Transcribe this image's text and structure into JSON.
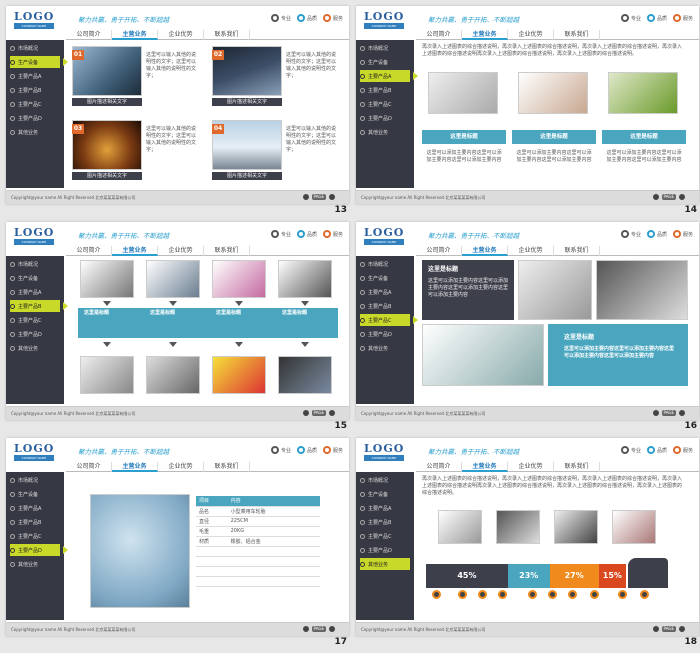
{
  "common": {
    "logo": "LOGO",
    "logo_sub": "COMPANY NAME",
    "slogan": "聚力共赢、勇于开拓、不断超越",
    "icons": [
      "专业",
      "品质",
      "服务"
    ],
    "tabs": [
      "公司简介",
      "主营业务",
      "企业优势",
      "联系我们"
    ],
    "sidebar": [
      "市场概况",
      "生产设备",
      "主要产品A",
      "主要产品B",
      "主要产品C",
      "主要产品D",
      "其他业务"
    ],
    "copyright": "Copyright@your name All Right Reserved 北京某某某某有限公司",
    "pager": "PAGE"
  },
  "slides": [
    {
      "number": "13",
      "active": 1,
      "items": [
        {
          "badge": "01",
          "caption": "图片描述相关文字",
          "text": "这里可以输入其他的说明性的文字；这里可以输入其他的说明性的文字；"
        },
        {
          "badge": "02",
          "caption": "图片描述相关文字",
          "text": "这里可以输入其他的说明性的文字；这里可以输入其他的说明性的文字；"
        },
        {
          "badge": "03",
          "caption": "图片描述相关文字",
          "text": "这里可以输入其他的说明性的文字；这里可以输入其他的说明性的文字；"
        },
        {
          "badge": "04",
          "caption": "图片描述相关文字",
          "text": "这里可以输入其他的说明性的文字；这里可以输入其他的说明性的文字；"
        }
      ]
    },
    {
      "number": "14",
      "active": 2,
      "intro": "再次录入上述图表的综合描述说明，再次录入上述图表的综合描述说明，再次录入上述图表的综合描述说明，再次录入上述图表的综合描述说明再次录入上述图表的综合描述说明，再次录入上述图表的综合描述说明。",
      "titles": [
        "这里是标题",
        "这里是标题",
        "这里是标题"
      ],
      "desc": "这里可以添加主要内容这里可以添加主要内容这里可以添加主要内容"
    },
    {
      "number": "15",
      "active": 3,
      "titles": [
        "这里是标题",
        "这里是标题",
        "这里是标题",
        "这里是标题"
      ]
    },
    {
      "number": "16",
      "active": 4,
      "box1_title": "这里是标题",
      "box1_text": "这里可以添加主要内容这里可以添加主要内容这里可以添加主要内容这里可以添加主要内容",
      "box2_title": "这里是标题",
      "box2_text": "这里可以添加主要内容这里可以添加主要内容这里可以添加主要内容这里可以添加主要内容"
    },
    {
      "number": "17",
      "active": 5,
      "table": {
        "head": [
          "项目",
          "内容"
        ],
        "rows": [
          [
            "品名",
            "小型乘用车轮胎"
          ],
          [
            "直径",
            "225CM"
          ],
          [
            "毛重",
            "20KG"
          ],
          [
            "材质",
            "橡胶、铝合金"
          ],
          [
            "",
            ""
          ],
          [
            "",
            ""
          ],
          [
            "",
            ""
          ],
          [
            "",
            ""
          ]
        ]
      }
    },
    {
      "number": "18",
      "active": 6,
      "intro": "再次录入上述图表的综合描述说明，再次录入上述图表的综合描述说明，再次录入上述图表的综合描述说明，再次录入上述图表的综合描述说明再次录入上述图表的综合描述说明，再次录入上述图表的综合描述说明，再次录入上述图表的综合描述说明。",
      "bars": [
        {
          "label": "45%",
          "value": 45,
          "color": "#3d3f4b"
        },
        {
          "label": "23%",
          "value": 23,
          "color": "#4aa6bf"
        },
        {
          "label": "27%",
          "value": 27,
          "color": "#f08a1c"
        },
        {
          "label": "15%",
          "value": 15,
          "color": "#d9481f"
        }
      ]
    }
  ]
}
